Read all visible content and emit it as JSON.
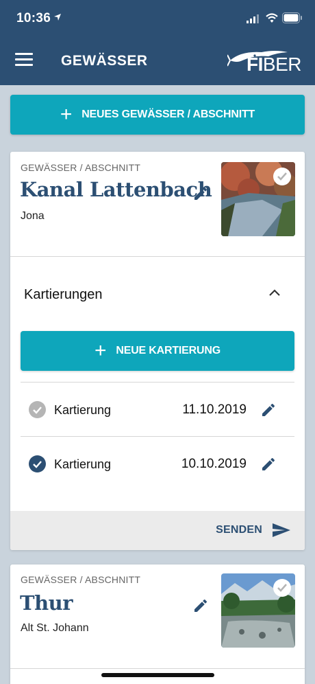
{
  "status": {
    "time": "10:36"
  },
  "appbar": {
    "title": "GEWÄSSER",
    "logo_left": "FI",
    "logo_right": "BER"
  },
  "actions": {
    "new_water": "NEUES GEWÄSSER / ABSCHNITT"
  },
  "waters": [
    {
      "overline": "GEWÄSSER / ABSCHNITT",
      "name": "Kanal Lattenbach",
      "location": "Jona",
      "section_title": "Kartierungen",
      "new_mapping": "NEUE KARTIERUNG",
      "mappings": [
        {
          "label": "Kartierung",
          "date": "11.10.2019",
          "sent": false
        },
        {
          "label": "Kartierung",
          "date": "10.10.2019",
          "sent": true
        }
      ],
      "send_label": "SENDEN"
    },
    {
      "overline": "GEWÄSSER / ABSCHNITT",
      "name": "Thur",
      "location": "Alt St. Johann"
    }
  ],
  "colors": {
    "primary": "#2c4f73",
    "accent": "#0ea6bb",
    "background": "#c9d3dc",
    "check_grey": "#b5b5b5"
  },
  "icons": [
    "location-arrow-icon",
    "signal-icon",
    "wifi-icon",
    "battery-icon",
    "menu-icon",
    "plus-icon",
    "edit-icon",
    "chevron-up-icon",
    "check-circle-icon",
    "send-icon"
  ]
}
